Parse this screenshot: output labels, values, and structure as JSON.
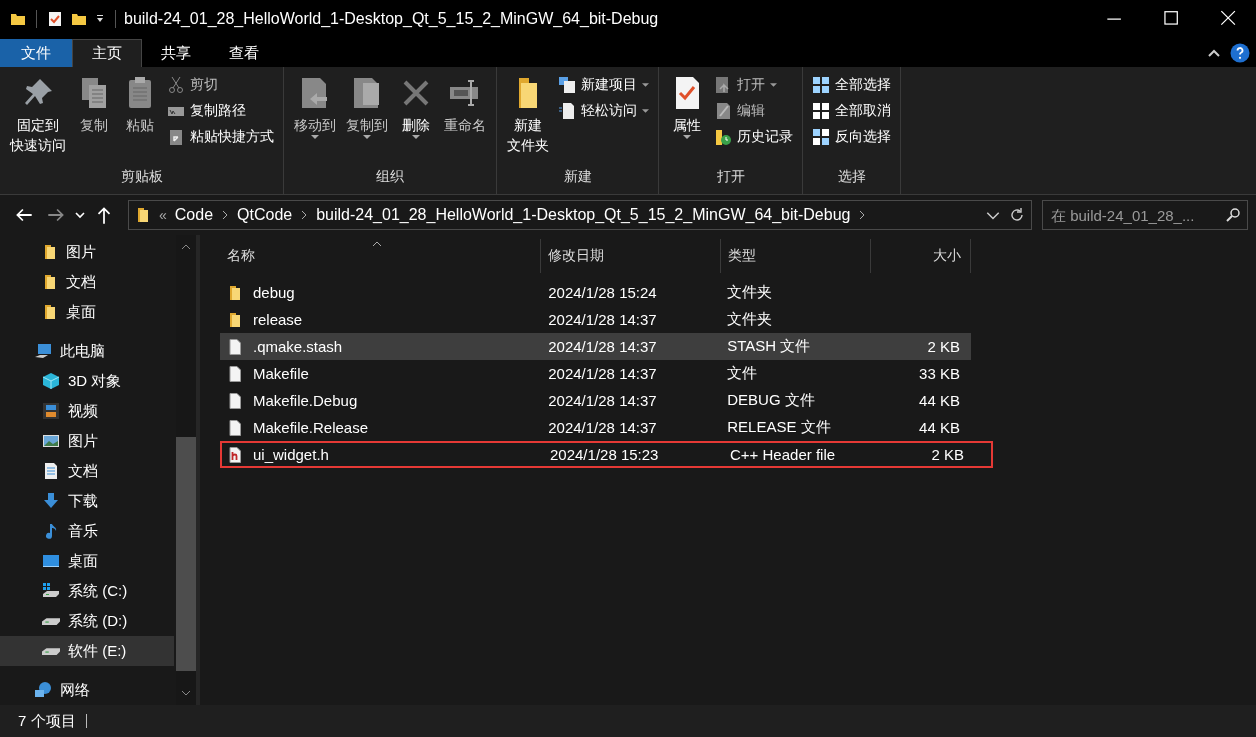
{
  "window": {
    "title": "build-24_01_28_HelloWorld_1-Desktop_Qt_5_15_2_MinGW_64_bit-Debug"
  },
  "ribbon_tabs": [
    {
      "label": "文件",
      "kind": "file",
      "selected": false
    },
    {
      "label": "主页",
      "kind": "tab",
      "selected": true
    },
    {
      "label": "共享",
      "kind": "tab",
      "selected": false
    },
    {
      "label": "查看",
      "kind": "tab",
      "selected": false
    }
  ],
  "ribbon_groups": [
    {
      "label": "剪贴板",
      "large": [
        {
          "label_lines": [
            "固定到",
            "快速访问"
          ],
          "kind": "pin",
          "disabled": false,
          "dropdown": false
        },
        {
          "label_lines": [
            "复制"
          ],
          "kind": "copy",
          "disabled": true,
          "dropdown": false
        },
        {
          "label_lines": [
            "粘贴"
          ],
          "kind": "paste",
          "disabled": true,
          "dropdown": false
        }
      ],
      "small": [
        {
          "label": "剪切",
          "kind": "cut",
          "disabled": true,
          "dropdown": false
        },
        {
          "label": "复制路径",
          "kind": "copypath",
          "disabled": false,
          "dropdown": false
        },
        {
          "label": "粘贴快捷方式",
          "kind": "pasteshortcut",
          "disabled": false,
          "dropdown": false
        }
      ]
    },
    {
      "label": "组织",
      "large": [
        {
          "label_lines": [
            "移动到"
          ],
          "kind": "move",
          "disabled": true,
          "dropdown": true
        },
        {
          "label_lines": [
            "复制到"
          ],
          "kind": "copyto",
          "disabled": true,
          "dropdown": true
        },
        {
          "label_lines": [
            "删除"
          ],
          "kind": "delete",
          "disabled": false,
          "dropdown": true
        },
        {
          "label_lines": [
            "重命名"
          ],
          "kind": "rename",
          "disabled": true,
          "dropdown": false
        }
      ]
    },
    {
      "label": "新建",
      "large": [
        {
          "label_lines": [
            "新建",
            "文件夹"
          ],
          "kind": "folder",
          "disabled": false,
          "dropdown": false
        }
      ],
      "small": [
        {
          "label": "新建项目",
          "kind": "newitem",
          "disabled": false,
          "dropdown": true
        },
        {
          "label": "轻松访问",
          "kind": "easyaccess",
          "disabled": false,
          "dropdown": true
        }
      ]
    },
    {
      "label": "打开",
      "large": [
        {
          "label_lines": [
            "属性"
          ],
          "kind": "properties",
          "disabled": false,
          "dropdown": true
        }
      ],
      "small": [
        {
          "label": "打开",
          "kind": "open",
          "disabled": true,
          "dropdown": true
        },
        {
          "label": "编辑",
          "kind": "edit",
          "disabled": true,
          "dropdown": false
        },
        {
          "label": "历史记录",
          "kind": "history",
          "disabled": false,
          "dropdown": false
        }
      ]
    },
    {
      "label": "选择",
      "small": [
        {
          "label": "全部选择",
          "kind": "selectall",
          "disabled": false,
          "dropdown": false
        },
        {
          "label": "全部取消",
          "kind": "selectnone",
          "disabled": false,
          "dropdown": false
        },
        {
          "label": "反向选择",
          "kind": "invert",
          "disabled": false,
          "dropdown": false
        }
      ]
    }
  ],
  "address_bar": {
    "overflow": "«",
    "segments": [
      "Code",
      "QtCode",
      "build-24_01_28_HelloWorld_1-Desktop_Qt_5_15_2_MinGW_64_bit-Debug"
    ]
  },
  "search": {
    "placeholder": "在 build-24_01_28_..."
  },
  "sidebar": {
    "quick_access_items": [
      {
        "label": "图片",
        "kind": "folder",
        "selected": false
      },
      {
        "label": "文档",
        "kind": "folder",
        "selected": false
      },
      {
        "label": "桌面",
        "kind": "folder",
        "selected": false
      }
    ],
    "this_pc": {
      "label": "此电脑",
      "kind": "pc",
      "selected": false,
      "children": [
        {
          "label": "3D 对象",
          "kind": "cube",
          "selected": false
        },
        {
          "label": "视频",
          "kind": "video",
          "selected": false
        },
        {
          "label": "图片",
          "kind": "picture",
          "selected": false
        },
        {
          "label": "文档",
          "kind": "document",
          "selected": false
        },
        {
          "label": "下载",
          "kind": "download",
          "selected": false
        },
        {
          "label": "音乐",
          "kind": "music",
          "selected": false
        },
        {
          "label": "桌面",
          "kind": "desktop",
          "selected": false
        },
        {
          "label": "系统 (C:)",
          "kind": "windrive",
          "selected": false
        },
        {
          "label": "系统 (D:)",
          "kind": "drive",
          "selected": false
        },
        {
          "label": "软件 (E:)",
          "kind": "drive",
          "selected": true
        }
      ]
    },
    "network": {
      "label": "网络",
      "kind": "network",
      "selected": false
    }
  },
  "file_list": {
    "columns": [
      "名称",
      "修改日期",
      "类型",
      "大小"
    ],
    "rows": [
      {
        "name": "debug",
        "kind": "folder",
        "modified": "2024/1/28 15:24",
        "type": "文件夹",
        "selected": false,
        "outlined": false
      },
      {
        "name": "release",
        "kind": "folder",
        "modified": "2024/1/28 14:37",
        "type": "文件夹",
        "selected": false,
        "outlined": false
      },
      {
        "name": ".qmake.stash",
        "kind": "file",
        "modified": "2024/1/28 14:37",
        "type": "STASH 文件",
        "size": "2 KB",
        "selected": true,
        "outlined": false
      },
      {
        "name": "Makefile",
        "kind": "file",
        "modified": "2024/1/28 14:37",
        "type": "文件",
        "size": "33 KB",
        "selected": false,
        "outlined": false
      },
      {
        "name": "Makefile.Debug",
        "kind": "file",
        "modified": "2024/1/28 14:37",
        "type": "DEBUG 文件",
        "size": "44 KB",
        "selected": false,
        "outlined": false
      },
      {
        "name": "Makefile.Release",
        "kind": "file",
        "modified": "2024/1/28 14:37",
        "type": "RELEASE 文件",
        "size": "44 KB",
        "selected": false,
        "outlined": false
      },
      {
        "name": "ui_widget.h",
        "kind": "header",
        "modified": "2024/1/28 15:23",
        "type": "C++ Header file",
        "size": "2 KB",
        "selected": false,
        "outlined": true
      }
    ]
  },
  "status_bar": {
    "item_count": "7 个项目"
  }
}
